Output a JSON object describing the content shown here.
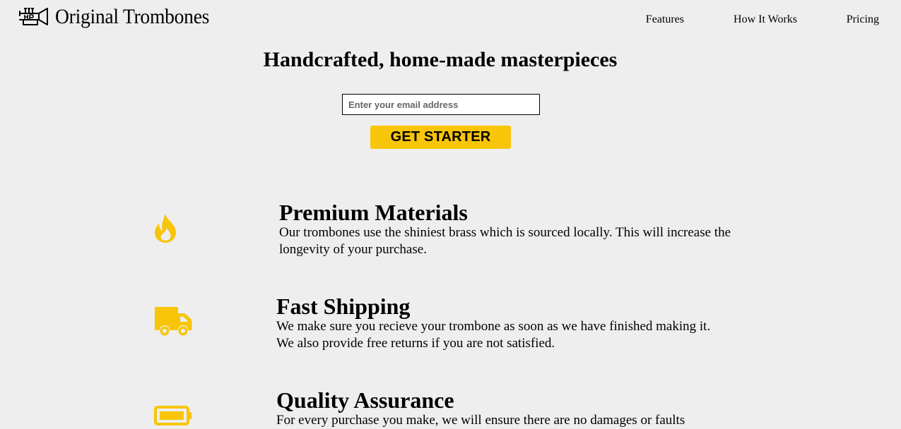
{
  "header": {
    "brand_name": "Original Trombones",
    "nav": [
      {
        "label": "Features"
      },
      {
        "label": "How It Works"
      },
      {
        "label": "Pricing"
      }
    ]
  },
  "hero": {
    "title": "Handcrafted, home-made masterpieces",
    "email_placeholder": "Enter your email address",
    "email_value": "",
    "submit_label": "GET STARTER"
  },
  "features": [
    {
      "icon": "fire-icon",
      "title": "Premium Materials",
      "description": "Our trombones use the shiniest brass which is sourced locally. This will increase the longevity of your purchase."
    },
    {
      "icon": "truck-icon",
      "title": "Fast Shipping",
      "description": "We make sure you recieve your trombone as soon as we have finished making it. We also provide free returns if you are not satisfied."
    },
    {
      "icon": "battery-icon",
      "title": "Quality Assurance",
      "description": "For every purchase you make, we will ensure there are no damages or faults"
    }
  ],
  "colors": {
    "background": "#eeeeee",
    "accent": "#f8c508",
    "icon": "#f8c508",
    "text": "#000000"
  }
}
